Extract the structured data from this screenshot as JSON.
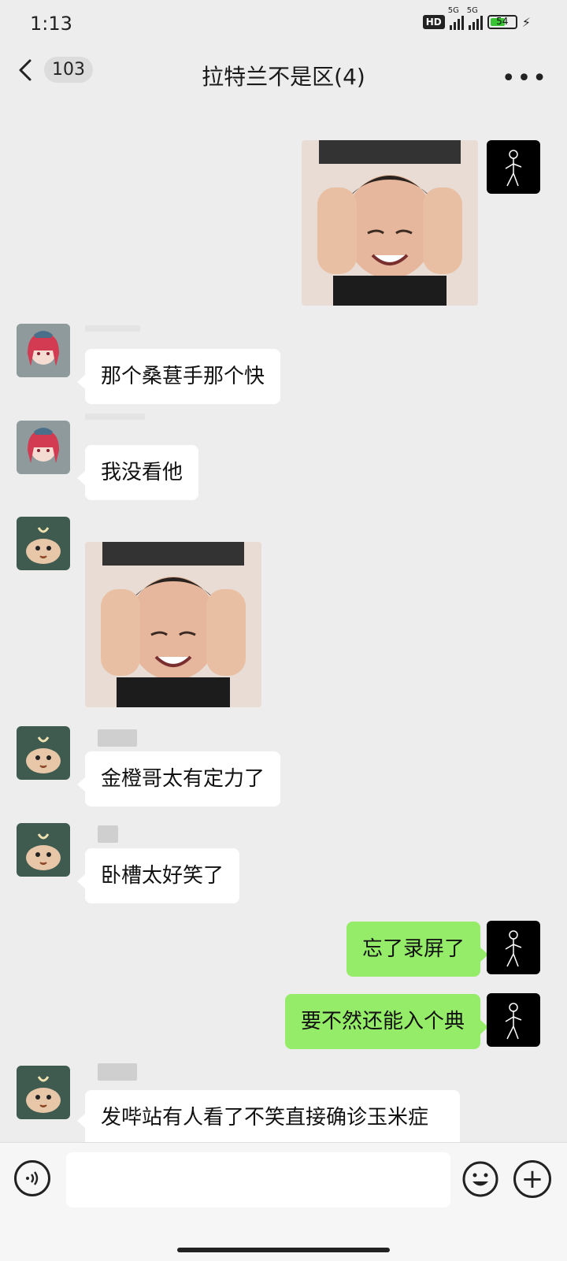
{
  "status_bar": {
    "time": "1:13",
    "hd": "HD",
    "net1": "5G",
    "net2": "5G",
    "battery": "54"
  },
  "header": {
    "unread_count": "103",
    "title": "拉特兰不是区(4)"
  },
  "messages": {
    "m2": "那个桑葚手那个快",
    "m3": "我没看他",
    "m5": "金橙哥太有定力了",
    "m6": "卧槽太好笑了",
    "m7": "忘了录屏了",
    "m8": "要不然还能入个典",
    "m9": "发哔站有人看了不笑直接确诊玉米症"
  },
  "icons": {
    "back": "chevron-left-icon",
    "more": "more-dots-icon",
    "voice": "voice-icon",
    "emoji": "emoji-icon",
    "plus": "plus-icon"
  },
  "colors": {
    "my_bubble": "#95ec69",
    "their_bubble": "#ffffff",
    "background": "#ededed"
  }
}
